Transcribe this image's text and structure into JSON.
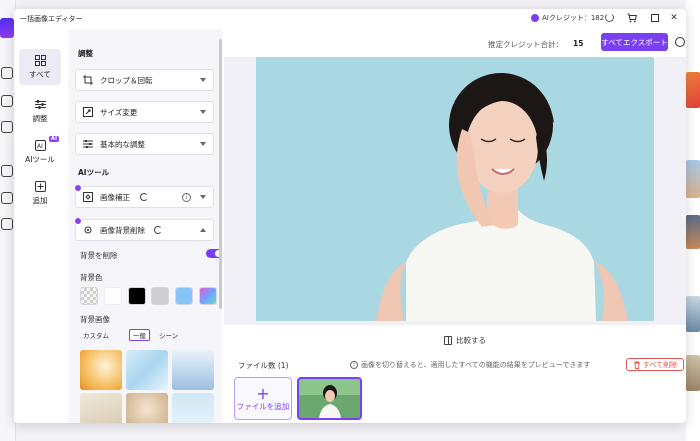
{
  "window": {
    "title": "一括画像エディター",
    "credit_label": "AIクレジット：182",
    "buttons": [
      "refresh",
      "cart",
      "maximize",
      "close"
    ]
  },
  "nav": {
    "items": [
      {
        "label": "すべて",
        "icon": "grid-icon",
        "active": true
      },
      {
        "label": "調整",
        "icon": "sliders-icon",
        "active": false
      },
      {
        "label": "AIツール",
        "icon": "ai-icon",
        "active": false,
        "badge": "AI"
      },
      {
        "label": "追加",
        "icon": "plus-box-icon",
        "active": false
      }
    ]
  },
  "panel": {
    "adjust_title": "調整",
    "crop_label": "クロップ＆回転",
    "resize_label": "サイズ変更",
    "basic_label": "基本的な調整",
    "ai_title": "AIツール",
    "enhance_label": "画像補正",
    "bg_remove_label": "画像背景削除",
    "remove_bg_label": "背景を削除",
    "remove_bg_on": true,
    "bg_color_label": "背景色",
    "bg_colors": [
      "transparent",
      "#ffffff",
      "#000000",
      "#cfcfcf",
      "#88c5fb",
      "gradient"
    ],
    "bg_image_label": "背景画像",
    "bg_image_tabs": [
      "カスタム",
      "一般",
      "シーン"
    ],
    "bg_image_tab_selected": "一般"
  },
  "main": {
    "est_label": "推定クレジット合計：",
    "est_value": "15",
    "export_label": "すべてエクスポート",
    "compare_label": "比較する",
    "files_label": "ファイル数 (1)",
    "hint": "画像を切り替えると、適用したすべての機能の結果をプレビューできます",
    "delete_all_label": "すべて削除",
    "add_file_label": "ファイルを追加"
  }
}
